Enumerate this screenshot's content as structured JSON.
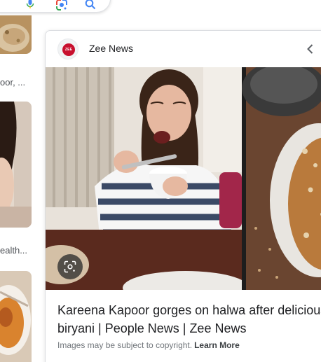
{
  "search": {
    "icons": [
      "microphone-icon",
      "google-lens-icon",
      "search-icon"
    ]
  },
  "left_results": {
    "caption1": "oor, ...",
    "caption2": "ealth..."
  },
  "panel": {
    "source_name": "Zee News",
    "source_logo_text": "ZEE",
    "title_line1": "Kareena Kapoor gorges on halwa after delicious",
    "title_line2": "biryani | People News | Zee News",
    "copyright_text": "Images may be subject to copyright.",
    "learn_more": "Learn More"
  },
  "colors": {
    "brand_red": "#c8102e",
    "text": "#202124",
    "muted": "#70757a"
  }
}
